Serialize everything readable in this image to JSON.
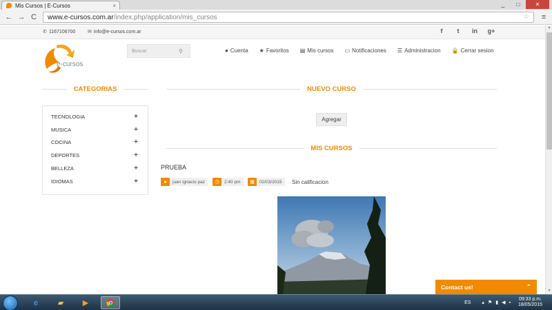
{
  "browser": {
    "tab_title": "Mis Cursos | E-Cursos",
    "tab_close": "×",
    "url_host": "www.e-cursos.com.ar",
    "url_path": "/index.php/application/mis_cursos",
    "back": "←",
    "forward": "→",
    "reload": "C",
    "star": "☆",
    "menu": "≡",
    "win_min": "_",
    "win_max": "□",
    "win_close": "✕"
  },
  "topbar": {
    "phone": "1167106700",
    "email": "info@e-cursos.com.ar",
    "social": [
      "f",
      "t",
      "in",
      "g+"
    ]
  },
  "logo": {
    "text": "e-cursos"
  },
  "search": {
    "placeholder": "Buscar"
  },
  "nav": [
    "Cuenta",
    "Favoritos",
    "Mis cursos",
    "Notificaciones",
    "Administracion",
    "Cerrar sesion"
  ],
  "sections": {
    "categorias": "CATEGORIAS",
    "nuevo_curso": "NUEVO CURSO",
    "mis_cursos": "MIS CURSOS"
  },
  "categories": [
    {
      "label": "TECNOLOGIA",
      "plus": "+"
    },
    {
      "label": "MUSICA",
      "plus": "+"
    },
    {
      "label": "COCINA",
      "plus": "+"
    },
    {
      "label": "DEPORTES",
      "plus": "+"
    },
    {
      "label": "BELLEZA",
      "plus": "+"
    },
    {
      "label": "IDIOMAS",
      "plus": "+"
    }
  ],
  "agregar": "Agregar",
  "course": {
    "title": "PRUEBA",
    "author": "juan ignacio paz",
    "time": "2:40 pm",
    "date": "02/03/2015",
    "rating": "Sin calificacion"
  },
  "contact_widget": {
    "label": "Contact us!",
    "chevron": "⌃"
  },
  "taskbar": {
    "lang": "ES",
    "time": "09:33 p.m.",
    "date": "18/05/2015"
  },
  "colors": {
    "accent": "#f28a00"
  }
}
